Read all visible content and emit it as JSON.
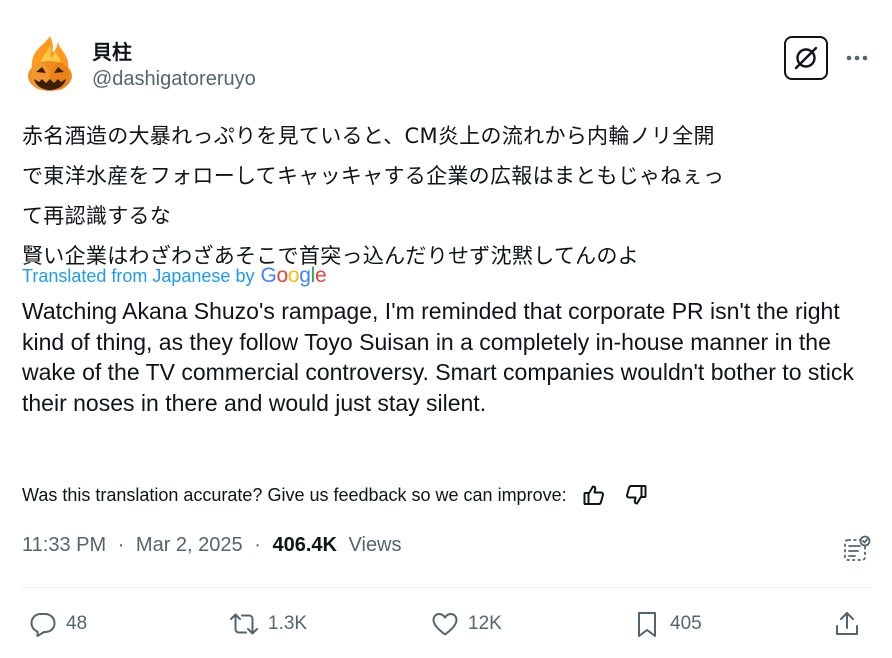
{
  "author": {
    "display_name": "貝柱",
    "handle": "@dashigatoreruyo",
    "avatar_icon": "jack-o-lantern-fire-icon"
  },
  "original_text_lines": [
    "赤名酒造の大暴れっぷりを見ていると、CM炎上の流れから内輪ノリ全開",
    "で東洋水産をフォローしてキャッキャする企業の広報はまともじゃねぇっ",
    "て再認識するな",
    "賢い企業はわざわざあそこで首突っ込んだりせず沈黙してんのよ"
  ],
  "translation": {
    "label": "Translated from Japanese by",
    "provider_letters": [
      "G",
      "o",
      "o",
      "g",
      "l",
      "e"
    ],
    "provider_colors": [
      "#4285F4",
      "#EA4335",
      "#FBBC05",
      "#4285F4",
      "#34A853",
      "#EA4335"
    ],
    "text": "Watching Akana Shuzo's rampage, I'm reminded that corporate PR isn't the right kind of thing, as they follow Toyo Suisan in a completely in-house manner in the wake of the TV commercial controversy. Smart companies wouldn't bother to stick their noses in there and would just stay silent.",
    "feedback_prompt": "Was this translation accurate? Give us feedback so we can improve:"
  },
  "meta": {
    "time": "11:33 PM",
    "separator": "·",
    "date": "Mar 2, 2025",
    "views_count": "406.4K",
    "views_label": "Views"
  },
  "actions": {
    "replies": "48",
    "reposts": "1.3K",
    "likes": "12K",
    "bookmarks": "405"
  },
  "colors": {
    "text": "#0f1419",
    "secondary": "#536471",
    "link": "#1d9bf0",
    "divider": "#eff3f4"
  }
}
